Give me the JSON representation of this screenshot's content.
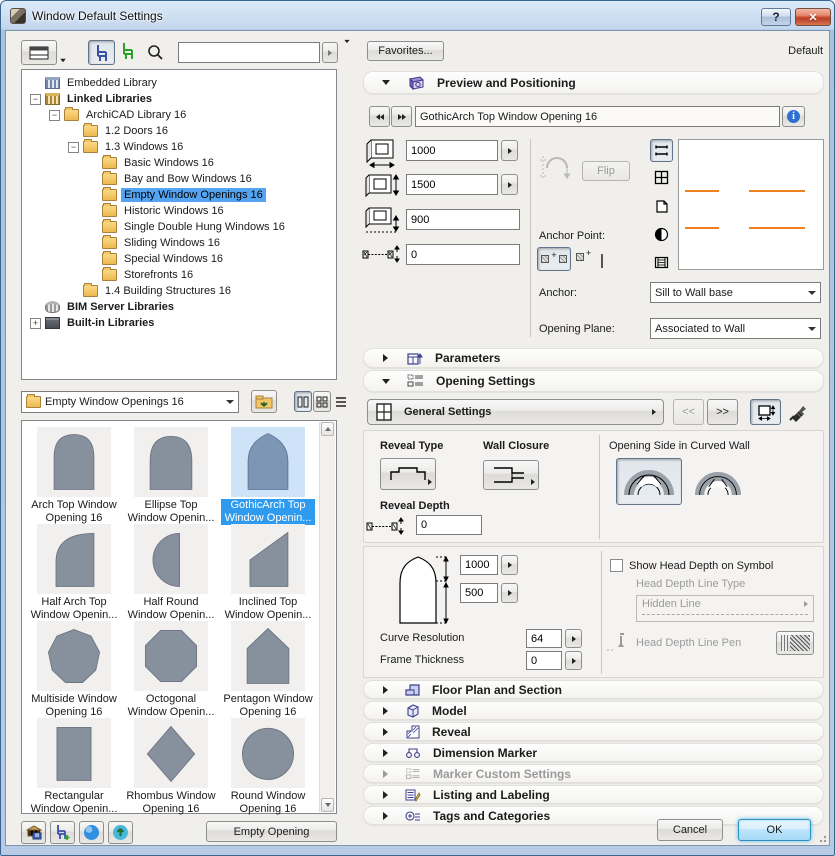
{
  "window": {
    "title": "Window Default Settings",
    "help_label": "?",
    "close_label": "✕"
  },
  "left": {
    "tree": {
      "items": [
        {
          "label": "Embedded Library",
          "level": 0,
          "icon": "embedded-library",
          "bold": false,
          "selected": false,
          "expander": "none"
        },
        {
          "label": "Linked Libraries",
          "level": 0,
          "icon": "linked-libraries",
          "bold": true,
          "selected": false,
          "expander": "minus"
        },
        {
          "label": "ArchiCAD Library 16",
          "level": 1,
          "icon": "folder",
          "bold": false,
          "selected": false,
          "expander": "minus"
        },
        {
          "label": "1.2 Doors 16",
          "level": 2,
          "icon": "folder",
          "bold": false,
          "selected": false,
          "expander": "none"
        },
        {
          "label": "1.3 Windows 16",
          "level": 2,
          "icon": "folder",
          "bold": false,
          "selected": false,
          "expander": "minus"
        },
        {
          "label": "Basic Windows 16",
          "level": 3,
          "icon": "folder",
          "bold": false,
          "selected": false,
          "expander": "none"
        },
        {
          "label": "Bay and Bow Windows 16",
          "level": 3,
          "icon": "folder",
          "bold": false,
          "selected": false,
          "expander": "none"
        },
        {
          "label": "Empty Window Openings 16",
          "level": 3,
          "icon": "folder",
          "bold": false,
          "selected": true,
          "expander": "none"
        },
        {
          "label": "Historic Windows 16",
          "level": 3,
          "icon": "folder",
          "bold": false,
          "selected": false,
          "expander": "none"
        },
        {
          "label": "Single Double Hung Windows 16",
          "level": 3,
          "icon": "folder",
          "bold": false,
          "selected": false,
          "expander": "none"
        },
        {
          "label": "Sliding Windows 16",
          "level": 3,
          "icon": "folder",
          "bold": false,
          "selected": false,
          "expander": "none"
        },
        {
          "label": "Special Windows 16",
          "level": 3,
          "icon": "folder",
          "bold": false,
          "selected": false,
          "expander": "none"
        },
        {
          "label": "Storefronts 16",
          "level": 3,
          "icon": "folder",
          "bold": false,
          "selected": false,
          "expander": "none"
        },
        {
          "label": "1.4 Building Structures 16",
          "level": 2,
          "icon": "folder",
          "bold": false,
          "selected": false,
          "expander": "none"
        },
        {
          "label": "BIM Server Libraries",
          "level": 0,
          "icon": "bim-server",
          "bold": true,
          "selected": false,
          "expander": "none"
        },
        {
          "label": "Built-in Libraries",
          "level": 0,
          "icon": "built-in",
          "bold": true,
          "selected": false,
          "expander": "plus"
        }
      ]
    },
    "folder_select": {
      "value": "Empty Window Openings 16"
    },
    "thumbnails": {
      "selected_index": 2,
      "items": [
        {
          "line1": "Arch Top Window",
          "line2": "Opening 16",
          "shape": "arch"
        },
        {
          "line1": "Ellipse Top",
          "line2": "Window Openin...",
          "shape": "ellipse"
        },
        {
          "line1": "GothicArch Top",
          "line2": "Window Openin...",
          "shape": "gothic"
        },
        {
          "line1": "Half Arch Top",
          "line2": "Window Openin...",
          "shape": "halfarch"
        },
        {
          "line1": "Half Round",
          "line2": "Window Openin...",
          "shape": "halfround"
        },
        {
          "line1": "Inclined Top",
          "line2": "Window Openin...",
          "shape": "inclined"
        },
        {
          "line1": "Multiside Window",
          "line2": "Opening 16",
          "shape": "multiside"
        },
        {
          "line1": "Octogonal",
          "line2": "Window Openin...",
          "shape": "octagon"
        },
        {
          "line1": "Pentagon Window",
          "line2": "Opening 16",
          "shape": "pentagon"
        },
        {
          "line1": "Rectangular",
          "line2": "Window Openin...",
          "shape": "rect"
        },
        {
          "line1": "Rhombus Window",
          "line2": "Opening 16",
          "shape": "rhombus"
        },
        {
          "line1": "Round Window",
          "line2": "Opening 16",
          "shape": "round"
        }
      ]
    },
    "empty_opening_button": "Empty Opening"
  },
  "right": {
    "favorites_button": "Favorites...",
    "default_label": "Default",
    "preview": {
      "title": "Preview and Positioning",
      "item_name": "GothicArch Top Window Opening 16",
      "width_value": "1000",
      "height_value": "1500",
      "sill_value": "900",
      "offset_value": "0",
      "flip_label": "Flip",
      "anchor_point_label": "Anchor Point:",
      "anchor_label": "Anchor:",
      "anchor_value": "Sill to Wall base",
      "opening_plane_label": "Opening Plane:",
      "opening_plane_value": "Associated to Wall"
    },
    "parameters": {
      "title": "Parameters"
    },
    "opening_settings": {
      "title": "Opening Settings",
      "general_button": "General Settings",
      "prev_label": "<<",
      "next_label": ">>",
      "reveal_type_label": "Reveal Type",
      "wall_closure_label": "Wall Closure",
      "opening_side_label": "Opening Side in Curved Wall",
      "reveal_depth_label": "Reveal Depth",
      "reveal_depth_value": "0",
      "shape_height_value": "1000",
      "shape_arch_value": "500",
      "curve_resolution_label": "Curve Resolution",
      "curve_resolution_value": "64",
      "frame_thickness_label": "Frame Thickness",
      "frame_thickness_value": "0",
      "show_head_depth_label": "Show Head Depth on Symbol",
      "head_line_type_label": "Head Depth Line Type",
      "head_line_type_value": "Hidden Line",
      "head_line_pen_label": "Head Depth Line Pen"
    },
    "collapsed_sections": [
      {
        "title": "Floor Plan and Section",
        "icon": "floor-plan-icon",
        "disabled": false
      },
      {
        "title": "Model",
        "icon": "model-icon",
        "disabled": false
      },
      {
        "title": "Reveal",
        "icon": "reveal-icon",
        "disabled": false
      },
      {
        "title": "Dimension Marker",
        "icon": "dimension-marker-icon",
        "disabled": false
      },
      {
        "title": "Marker Custom Settings",
        "icon": "marker-custom-icon",
        "disabled": true
      },
      {
        "title": "Listing and Labeling",
        "icon": "listing-icon",
        "disabled": false
      },
      {
        "title": "Tags and Categories",
        "icon": "tags-icon",
        "disabled": false
      }
    ],
    "cancel_button": "Cancel",
    "ok_button": "OK"
  }
}
